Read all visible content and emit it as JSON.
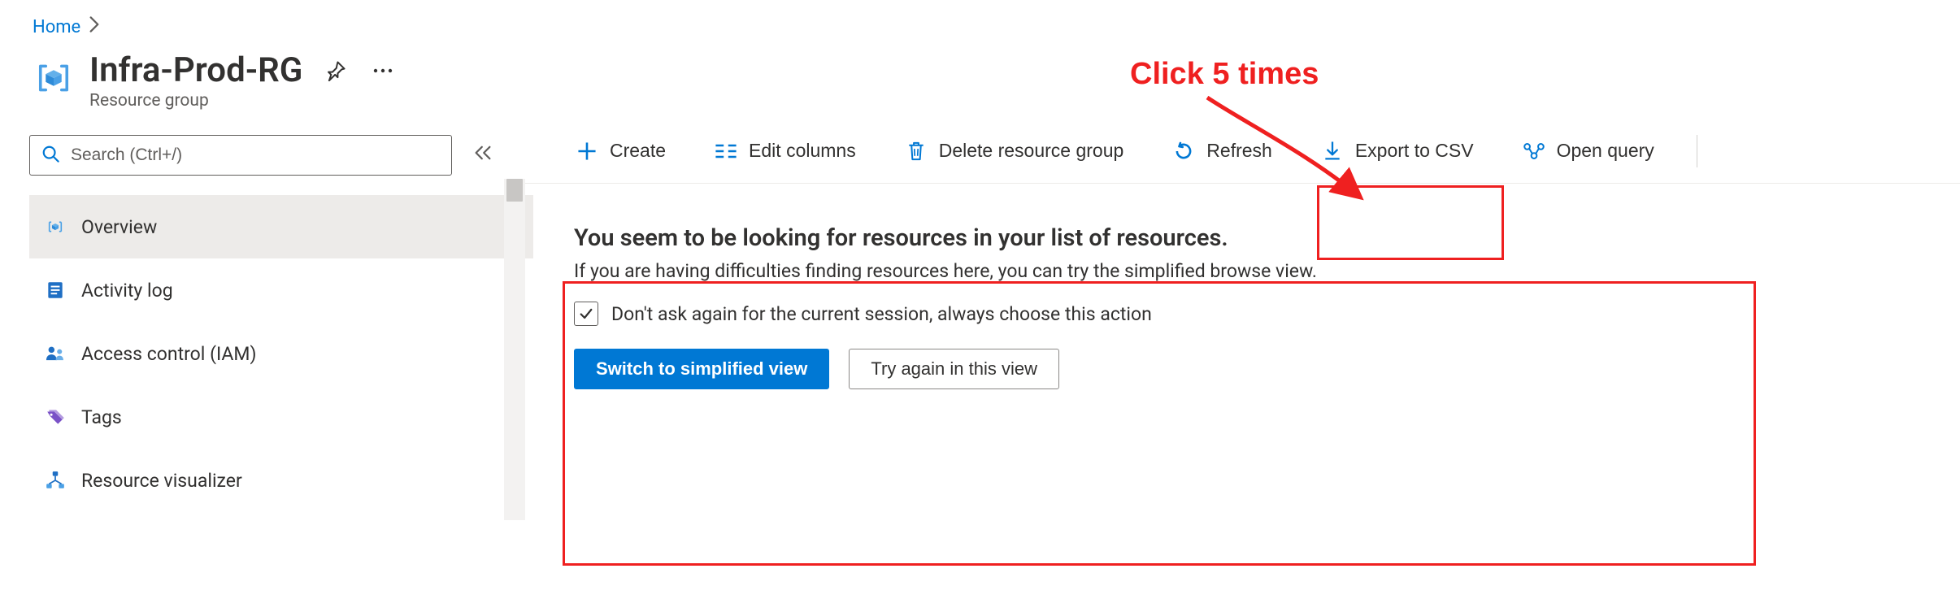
{
  "breadcrumb": {
    "home": "Home"
  },
  "header": {
    "title": "Infra-Prod-RG",
    "subtitle": "Resource group"
  },
  "sidebar": {
    "search_placeholder": "Search (Ctrl+/)",
    "items": [
      {
        "label": "Overview",
        "icon": "rg-icon",
        "selected": true
      },
      {
        "label": "Activity log",
        "icon": "log-icon",
        "selected": false
      },
      {
        "label": "Access control (IAM)",
        "icon": "iam-icon",
        "selected": false
      },
      {
        "label": "Tags",
        "icon": "tag-icon",
        "selected": false
      },
      {
        "label": "Resource visualizer",
        "icon": "visualizer-icon",
        "selected": false
      }
    ]
  },
  "toolbar": {
    "create": "Create",
    "edit_columns": "Edit columns",
    "delete_rg": "Delete resource group",
    "refresh": "Refresh",
    "export_csv": "Export to CSV",
    "open_query": "Open query"
  },
  "message": {
    "title": "You seem to be looking for resources in your list of resources.",
    "description": "If you are having difficulties finding resources here, you can try the simplified browse view.",
    "checkbox_label": "Don't ask again for the current session, always choose this action",
    "checkbox_checked": true,
    "primary_btn": "Switch to simplified view",
    "secondary_btn": "Try again in this view"
  },
  "annotation": {
    "text": "Click 5 times"
  }
}
